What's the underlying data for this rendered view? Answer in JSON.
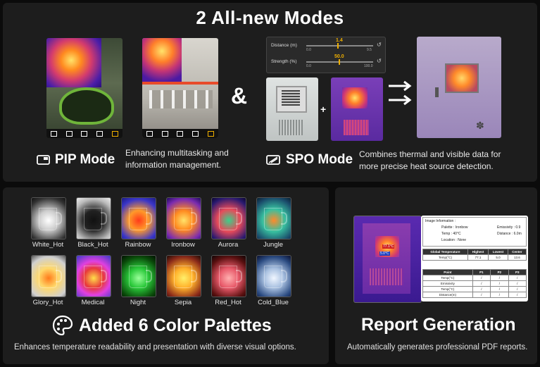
{
  "header": {
    "title": "2  All-new Modes"
  },
  "pip": {
    "label": "PIP Mode",
    "desc_line1": "Enhancing multitasking and",
    "desc_line2": "information management."
  },
  "ampersand": "&",
  "spo": {
    "label": "SPO Mode",
    "desc_line1": "Combines thermal and visible data for",
    "desc_line2": "more precise heat source detection.",
    "distance_label": "Distance",
    "distance_unit": "(m)",
    "distance_value": "1.4",
    "distance_min": "0.0",
    "distance_max": "9.5",
    "strength_label": "Strength",
    "strength_unit": "(%)",
    "strength_value": "50.0",
    "strength_min": "0.0",
    "strength_max": "100.0",
    "plus": "+"
  },
  "palettes": {
    "heading": "Added 6 Color Palettes",
    "subtext": "Enhances temperature readability and presentation with diverse visual options.",
    "items": [
      {
        "name": "White_Hot"
      },
      {
        "name": "Black_Hot"
      },
      {
        "name": "Rainbow"
      },
      {
        "name": "Ironbow"
      },
      {
        "name": "Aurora"
      },
      {
        "name": "Jungle"
      },
      {
        "name": "Glory_Hot"
      },
      {
        "name": "Medical"
      },
      {
        "name": "Night"
      },
      {
        "name": "Sepia"
      },
      {
        "name": "Red_Hot"
      },
      {
        "name": "Cold_Blue"
      }
    ]
  },
  "report": {
    "heading": "Report Generation",
    "subtext": "Automatically generates professional PDF reports.",
    "info_title": "Image Information :",
    "palette": "Palette : Ironbow",
    "emissivity": "Emissivity : 0.9",
    "temp": "Temp : 40°C",
    "distance": "Distance : 6.0m",
    "location": "Location : None",
    "global_header": [
      "Global Temperature",
      "Highest",
      "Lowest",
      "Center"
    ],
    "global_row": [
      "Temp(°C)",
      "77.1",
      "5.0",
      "13.6"
    ],
    "point_header": [
      "Point",
      "P1",
      "P2",
      "P3"
    ],
    "point_rows": [
      [
        "Temp(°C)",
        "/",
        "/",
        "/"
      ],
      [
        "Emissivity",
        "/",
        "/",
        "/"
      ],
      [
        "Temp(°C)",
        "/",
        "/",
        "/"
      ],
      [
        "Distance(m)",
        "/",
        "/",
        "/"
      ]
    ],
    "marker_max": "77.1°C",
    "marker_min": "5.0°C"
  }
}
